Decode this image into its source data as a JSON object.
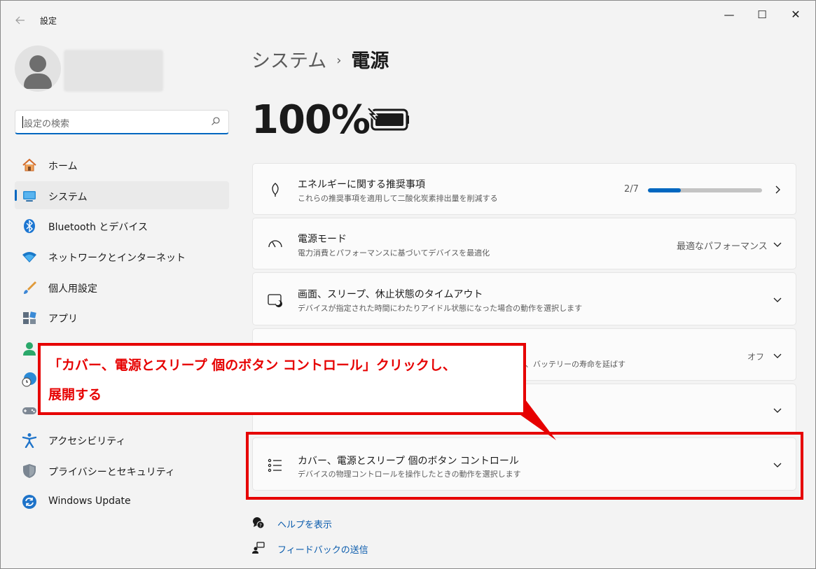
{
  "window": {
    "title": "設定",
    "controls": {
      "minimize": "—",
      "maximize": "☐",
      "close": "✕"
    }
  },
  "search": {
    "placeholder": "設定の検索"
  },
  "sidebar": {
    "items": [
      {
        "label": "ホーム",
        "icon": "home-icon"
      },
      {
        "label": "システム",
        "icon": "system-icon",
        "selected": true
      },
      {
        "label": "Bluetooth とデバイス",
        "icon": "bluetooth-icon"
      },
      {
        "label": "ネットワークとインターネット",
        "icon": "wifi-icon"
      },
      {
        "label": "個人用設定",
        "icon": "brush-icon"
      },
      {
        "label": "アプリ",
        "icon": "apps-icon"
      },
      {
        "label": "",
        "icon": "accounts-icon"
      },
      {
        "label": "",
        "icon": "time-language-icon"
      },
      {
        "label": "",
        "icon": "gaming-icon"
      },
      {
        "label": "アクセシビリティ",
        "icon": "accessibility-icon"
      },
      {
        "label": "プライバシーとセキュリティ",
        "icon": "shield-icon"
      },
      {
        "label": "Windows Update",
        "icon": "update-icon"
      }
    ]
  },
  "breadcrumb": {
    "parent": "システム",
    "separator": "›",
    "current": "電源"
  },
  "battery": {
    "percent_text": "100%",
    "charge_level": 1.0
  },
  "cards": {
    "energy": {
      "title": "エネルギーに関する推奨事項",
      "desc": "これらの推奨事項を適用して二酸化炭素排出量を削減する",
      "count": "2/7",
      "progress": 0.2857
    },
    "power_mode": {
      "title": "電源モード",
      "desc": "電力消費とパフォーマンスに基づいてデバイスを最適化",
      "value": "最適なパフォーマンス"
    },
    "screen_sleep": {
      "title": "画面、スリープ、休止状態のタイムアウト",
      "desc": "デバイスが指定された時間にわたりアイドル状態になった場合の動作を選択します"
    },
    "battery_saver": {
      "desc_partial": "を削減し、バッテリーの寿命を延ばす",
      "value": "オフ"
    },
    "lid_buttons": {
      "title": "カバー、電源とスリープ 個のボタン コントロール",
      "desc": "デバイスの物理コントロールを操作したときの動作を選択します"
    }
  },
  "footer": {
    "help": "ヘルプを表示",
    "feedback": "フィードバックの送信"
  },
  "annotation": {
    "line1": "「カバー、電源とスリープ 個のボタン コントロール」クリックし、",
    "line2": "展開する",
    "color": "#e60000"
  }
}
